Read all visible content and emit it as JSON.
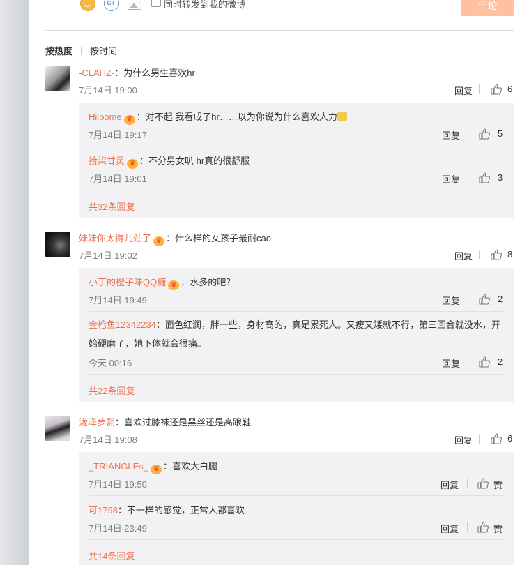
{
  "composer": {
    "repost_label": "同时转发到我的微博",
    "submit_label": "评论",
    "gif_label": "GIF"
  },
  "sort": {
    "hot": "按热度",
    "time": "按时间"
  },
  "icons": {
    "verified": "crown-badge-icon",
    "like": "thumb-up-icon"
  },
  "reply_label": "回复",
  "comments": [
    {
      "user": "-CLAHZ-",
      "text": "：为什么男生喜欢hr",
      "time": "7月14日 19:00",
      "likes": "6",
      "replies": [
        {
          "user": "Hiipome",
          "text": "：对不起 我看成了hr……以为你说为什么喜欢人力",
          "time": "7月14日 19:17",
          "likes": "5"
        },
        {
          "user": "拾柒廿灵",
          "text": "：不分男女叭 hr真的很舒服",
          "time": "7月14日 19:01",
          "likes": "3"
        }
      ],
      "more": "共32条回复"
    },
    {
      "user": "妹妹你太得儿劲了",
      "text": "：什么样的女孩子最耐cao",
      "time": "7月14日 19:02",
      "likes": "8",
      "replies": [
        {
          "user": "小丁的橙子味QQ糖",
          "text": "：水多的吧？",
          "time": "7月14日 19:49",
          "likes": "2"
        },
        {
          "user": "金枪鱼12342234",
          "text": "：面色红润，胖一些，身材高的，真是累死人。又瘦又矮就不行，第三回合就没水，开始硬磨了，她下体就会很痛。",
          "time": "今天 00:16",
          "likes": "2"
        }
      ],
      "more": "共22条回复"
    },
    {
      "user": "泷泽萝翾",
      "text": "：喜欢过膝袜还是黑丝还是高跟鞋",
      "time": "7月14日 19:08",
      "likes": "6",
      "replies": [
        {
          "user": "_TRIANGLEs_",
          "text": "：喜欢大白腿",
          "time": "7月14日 19:50",
          "likes": "赞"
        },
        {
          "user": "可1798",
          "text": "：不一样的感觉，正常人都喜欢",
          "time": "7月14日 23:49",
          "likes": "赞"
        }
      ],
      "more": "共14条回复"
    }
  ]
}
